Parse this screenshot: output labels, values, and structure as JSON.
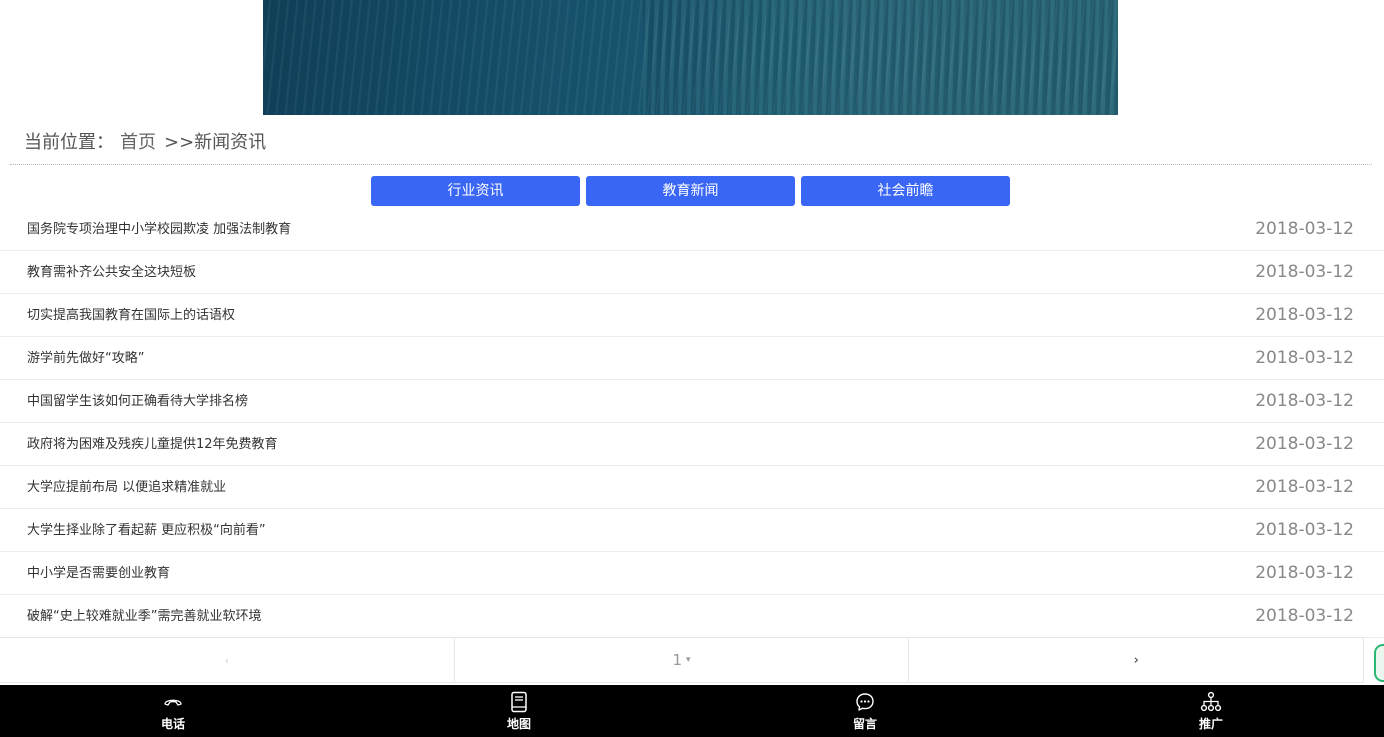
{
  "breadcrumb": {
    "label": "当前位置：",
    "home": "首页",
    "current": ">>新闻资讯"
  },
  "categories": [
    {
      "label": "行业资讯"
    },
    {
      "label": "教育新闻"
    },
    {
      "label": "社会前瞻"
    }
  ],
  "news": [
    {
      "title": "国务院专项治理中小学校园欺凌 加强法制教育",
      "date": "2018-03-12"
    },
    {
      "title": "教育需补齐公共安全这块短板",
      "date": "2018-03-12"
    },
    {
      "title": "切实提高我国教育在国际上的话语权",
      "date": "2018-03-12"
    },
    {
      "title": "游学前先做好“攻略”",
      "date": "2018-03-12"
    },
    {
      "title": "中国留学生该如何正确看待大学排名榜",
      "date": "2018-03-12"
    },
    {
      "title": "政府将为困难及残疾儿童提供12年免费教育",
      "date": "2018-03-12"
    },
    {
      "title": "大学应提前布局 以便追求精准就业",
      "date": "2018-03-12"
    },
    {
      "title": "大学生择业除了看起薪 更应积极“向前看”",
      "date": "2018-03-12"
    },
    {
      "title": "中小学是否需要创业教育",
      "date": "2018-03-12"
    },
    {
      "title": "破解“史上较难就业季”需完善就业软环境",
      "date": "2018-03-12"
    }
  ],
  "pager": {
    "prev": "‹",
    "page": "1",
    "caret": "▾",
    "next": "›"
  },
  "bottom_bar": [
    {
      "label": "电话",
      "icon": "phone-icon"
    },
    {
      "label": "地图",
      "icon": "map-book-icon"
    },
    {
      "label": "留言",
      "icon": "message-icon"
    },
    {
      "label": "推广",
      "icon": "share-tree-icon"
    }
  ],
  "colors": {
    "accent": "#3a66f5",
    "bar_bg": "#000000",
    "date": "#888888"
  }
}
